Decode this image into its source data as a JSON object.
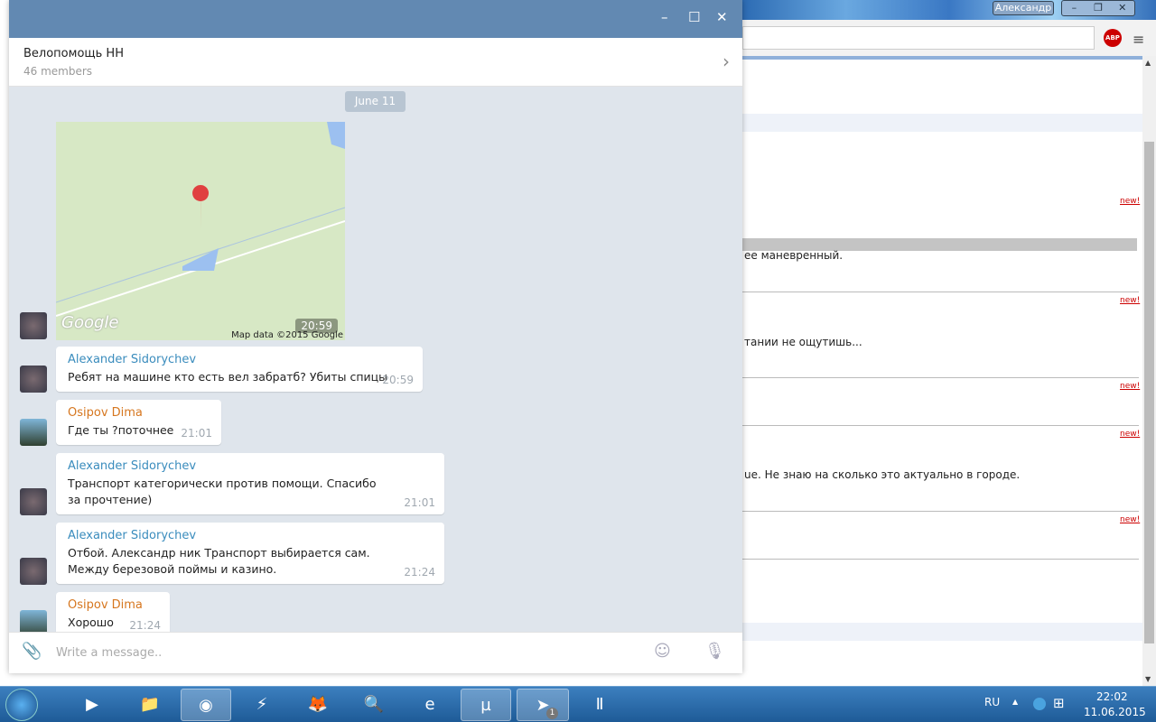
{
  "browser": {
    "user": "Александр",
    "min": "–",
    "restore": "❐",
    "close": "✕",
    "abp": "ABP",
    "menu": "≡",
    "texts": [
      "ее маневренный.",
      "тании не ощутишь...",
      "ue. Не знаю на сколько это актуально в городе."
    ],
    "new_label": "new!"
  },
  "telegram": {
    "title_buttons": {
      "min": "–",
      "max": "☐",
      "close": "✕"
    },
    "chat_name": "Велопомощь НН",
    "members": "46 members",
    "date": "June 11",
    "map": {
      "attribution": "Map data ©2015 Google",
      "logo": "Google",
      "time": "20:59"
    },
    "messages": [
      {
        "author": "Alexander Sidorychev",
        "text": "Ребят на машине кто есть вел забратб? Убиты спицы",
        "time": "20:59"
      },
      {
        "author": "Osipov Dima",
        "text": "Где ты ?поточнее",
        "time": "21:01"
      },
      {
        "author": "Alexander Sidorychev",
        "text": "Транспорт категорически против помощи. Спасибо за прочтение)",
        "time": "21:01"
      },
      {
        "author": "Alexander Sidorychev",
        "text": "Отбой. Александр ник Транспорт выбирается сам. Между березовой поймы и казино.",
        "time": "21:24"
      },
      {
        "author": "Osipov Dima",
        "text": "Хорошо",
        "time": "21:24"
      }
    ],
    "input_placeholder": "Write a message..",
    "colors": {
      "title": "#6289b2",
      "chat_bg": "#dfe5ec",
      "author_blue": "#3a8cbd",
      "author_orange": "#d6761e"
    }
  },
  "taskbar": {
    "lang": "RU",
    "time": "22:02",
    "date": "11.06.2015",
    "telegram_badge": "1"
  }
}
